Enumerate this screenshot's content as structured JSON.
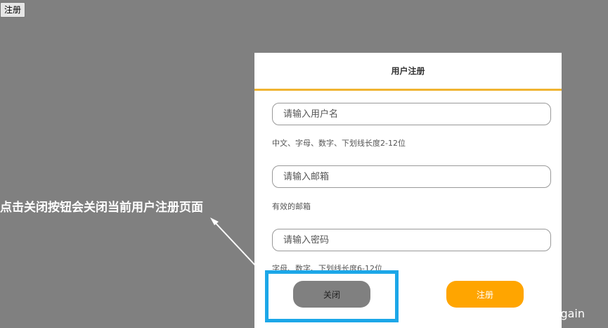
{
  "page": {
    "open_button_label": "注册"
  },
  "dialog": {
    "title": "用户注册",
    "fields": [
      {
        "placeholder": "请输入用户名",
        "hint": "中文、字母、数字、下划线长度2-12位"
      },
      {
        "placeholder": "请输入邮箱",
        "hint": "有效的邮箱"
      },
      {
        "placeholder": "请输入密码",
        "hint": "字母、数字、下划线长度6-12位"
      }
    ],
    "close_label": "关闭",
    "register_label": "注册"
  },
  "annotation": {
    "text": "点击关闭按钮会关闭当前用户注册页面"
  },
  "watermark": "CSDN @Insomnia_again",
  "colors": {
    "overlay": "#808080",
    "accent": "#f0b431",
    "register_button": "#ffa500",
    "close_button": "#808080",
    "highlight": "#1ca7e8"
  }
}
